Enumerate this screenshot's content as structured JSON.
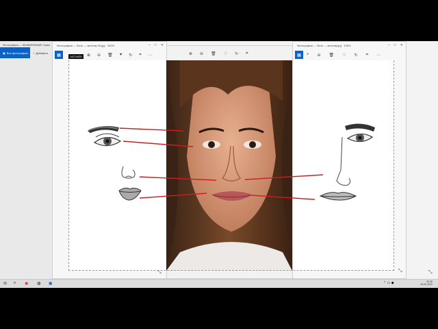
{
  "background_app": {
    "title": "Фотографии — 8548AEB08A8F-Храм",
    "tab_label": "Все фотографии",
    "add_label": "Добавить"
  },
  "windows": {
    "left": {
      "title": "Фотографии — Фото — монтаж 40.jpg · 100%",
      "dim_badge": "1427x925"
    },
    "right": {
      "title": "Фотографии — Фото — монтаж.jpg · 100%"
    }
  },
  "taskbar": {
    "time": "20:36",
    "date": "09.02.2022"
  },
  "colors": {
    "accent": "#0a63c8",
    "annotation_line": "#cc1f1f"
  }
}
